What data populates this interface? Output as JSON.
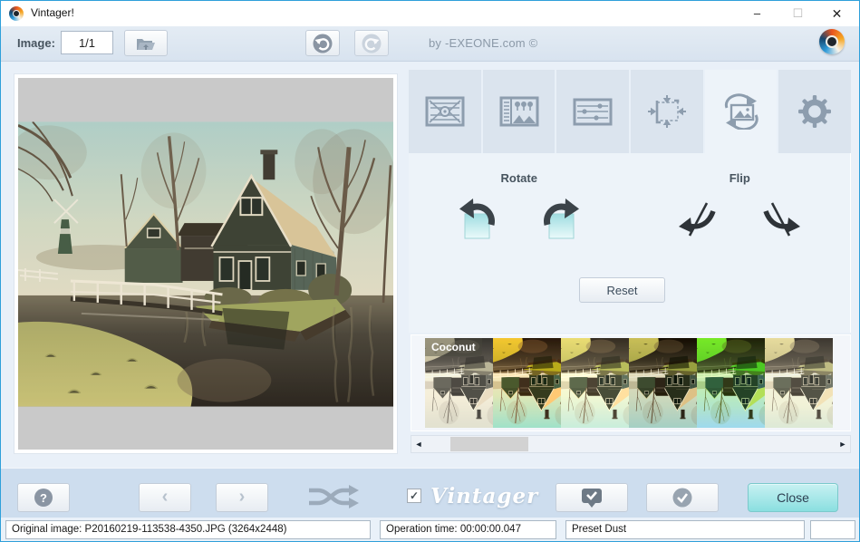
{
  "window": {
    "title": "Vintager!",
    "controls": {
      "minimize": "–",
      "maximize": "☐",
      "close": "✕"
    }
  },
  "toolbar": {
    "image_label": "Image:",
    "image_value": "1/1",
    "byline": "by -EXEONE.com ©"
  },
  "tabs": [
    {
      "name": "effects-tab"
    },
    {
      "name": "presets-tab"
    },
    {
      "name": "adjustments-tab"
    },
    {
      "name": "resize-tab"
    },
    {
      "name": "rotate-flip-tab",
      "active": true
    },
    {
      "name": "settings-tab"
    }
  ],
  "rotate_flip": {
    "rotate_title": "Rotate",
    "flip_title": "Flip",
    "reset_label": "Reset"
  },
  "thumbnails": [
    {
      "label": "Coconut",
      "style": "filter: grayscale(0.65) sepia(0.28) brightness(1.1) contrast(0.92)"
    },
    {
      "label": "",
      "style": "filter: saturate(1.9) contrast(1.15) hue-rotate(-8deg)"
    },
    {
      "label": "",
      "style": "filter: saturate(1.35) brightness(1.12) sepia(0.12)"
    },
    {
      "label": "",
      "style": "filter: contrast(1.28) saturate(1.2) brightness(0.9)"
    },
    {
      "label": "",
      "style": "filter: saturate(2.2) hue-rotate(35deg) contrast(1.1)"
    },
    {
      "label": "",
      "style": "filter: saturate(0.85) brightness(1.15) sepia(0.25) contrast(0.9)"
    }
  ],
  "scrollbar": {
    "left_arrow": "◄",
    "right_arrow": "►"
  },
  "footer": {
    "help_glyph": "?",
    "prev_glyph": "‹",
    "next_glyph": "›",
    "vintager_checked": "✓",
    "vintager_label": "Vintager",
    "close_label": "Close"
  },
  "statusbar": {
    "original_image": "Original image: P20160219-113538-4350.JPG (3264x2448)",
    "operation_time": "Operation time: 00:00:00.047",
    "preset": "Preset Dust",
    "extra": ""
  },
  "colors": {
    "accent_close": "#8adfe0",
    "window_border": "#2fa0da",
    "icon_gray": "#8d9dae",
    "rotate_square": "#aee4e6"
  }
}
